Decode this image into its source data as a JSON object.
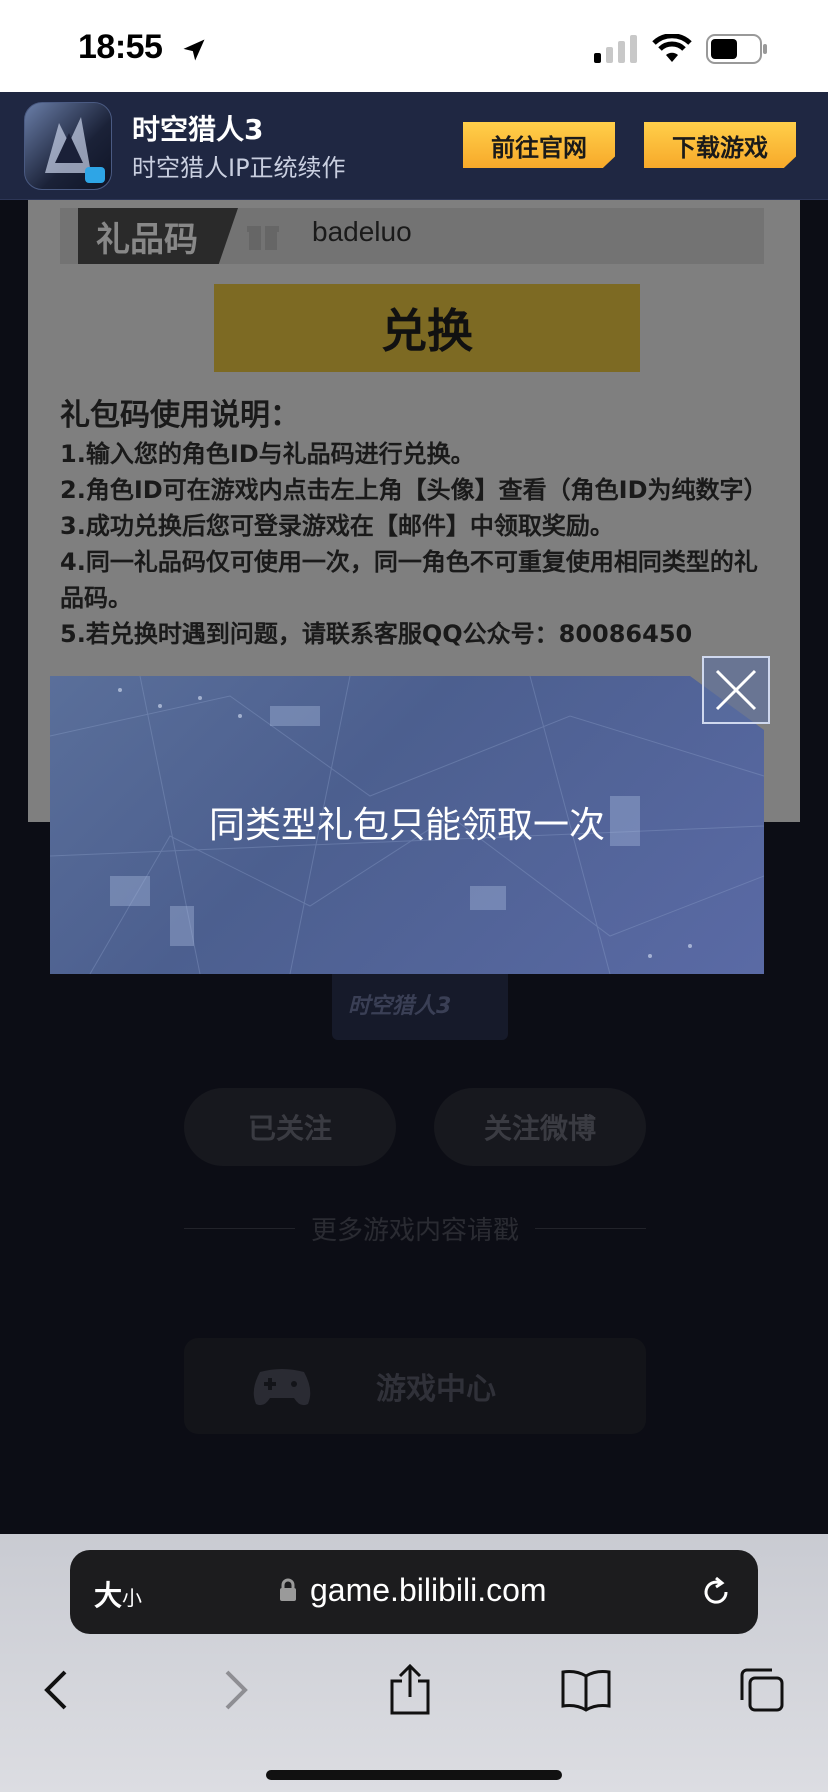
{
  "status_bar": {
    "time": "18:55"
  },
  "app_banner": {
    "name": "时空猎人3",
    "subtitle": "时空猎人IP正统续作",
    "official_site_label": "前往官网",
    "download_label": "下载游戏"
  },
  "gift_form": {
    "gift_code_label": "礼品码",
    "gift_code_value": "badeluo",
    "redeem_label": "兑换"
  },
  "instructions": {
    "title": "礼包码使用说明：",
    "items": [
      "1.输入您的角色ID与礼品码进行兑换。",
      "2.角色ID可在游戏内点击左上角【头像】查看（角色ID为纯数字）",
      "3.成功兑换后您可登录游戏在【邮件】中领取奖励。",
      "4.同一礼品码仅可使用一次，同一角色不可重复使用相同类型的礼品码。",
      "5.若兑换时遇到问题，请联系客服QQ公众号：80086450"
    ]
  },
  "follow": {
    "logo_text": "时空猎人3",
    "followed_label": "已关注",
    "weibo_label": "关注微博",
    "more_label": "更多游戏内容请戳",
    "game_center_label": "游戏中心"
  },
  "modal": {
    "message": "同类型礼包只能领取一次"
  },
  "browser": {
    "text_size_big": "大",
    "text_size_small": "小",
    "url": "game.bilibili.com"
  },
  "colors": {
    "banner_bg": "#1f2742",
    "accent_yellow": "#f7b52e",
    "modal_bg": "#5063a0"
  }
}
